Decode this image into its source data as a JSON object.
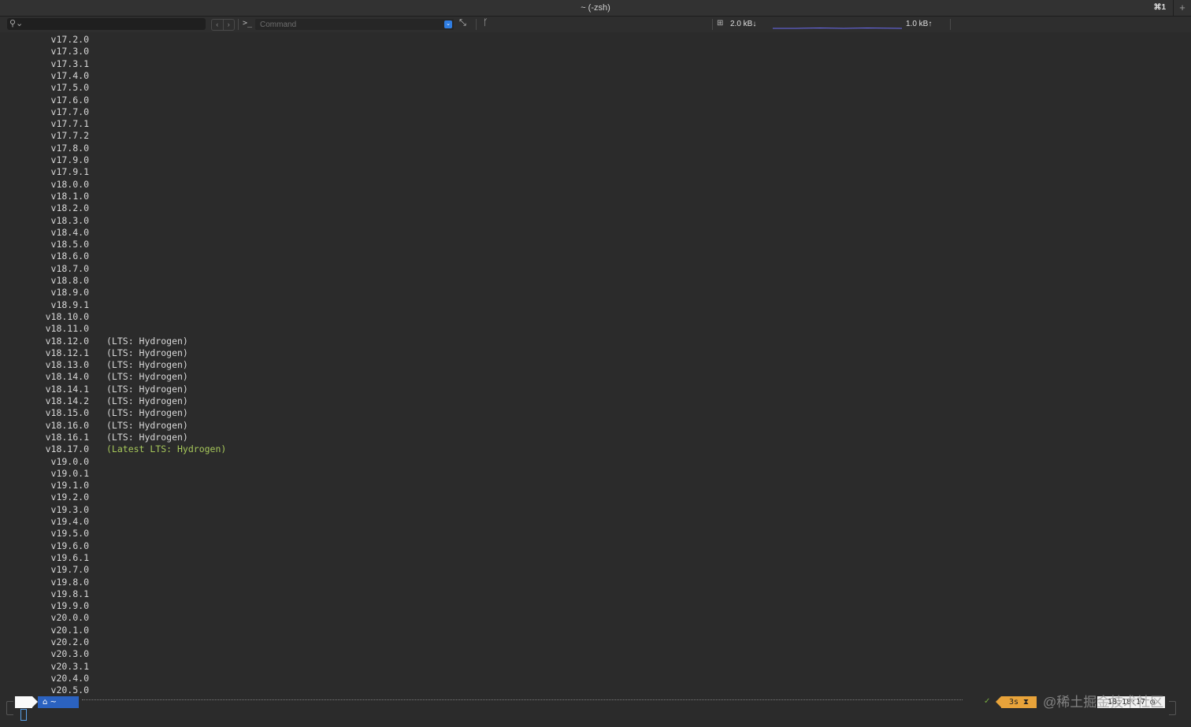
{
  "window": {
    "title": "~ (-zsh)",
    "tab_shortcut": "⌘1",
    "add_tab_icon": "+"
  },
  "toolbar": {
    "search_icon": "⚲⌄",
    "nav_back_icon": "‹",
    "nav_forward_icon": "›",
    "prompt_icon": ">_",
    "command_placeholder": "Command",
    "command_dropdown_icon": "⌄",
    "expand_icon": "⤡",
    "branch_icon": "ᚴ",
    "network_icon": "⊞",
    "network_down": "2.0 kB↓",
    "network_up": "1.0 kB↑",
    "graph_color": "#6b6bf0"
  },
  "terminal": {
    "lines": [
      {
        "version": "v17.2.0",
        "note": ""
      },
      {
        "version": "v17.3.0",
        "note": ""
      },
      {
        "version": "v17.3.1",
        "note": ""
      },
      {
        "version": "v17.4.0",
        "note": ""
      },
      {
        "version": "v17.5.0",
        "note": ""
      },
      {
        "version": "v17.6.0",
        "note": ""
      },
      {
        "version": "v17.7.0",
        "note": ""
      },
      {
        "version": "v17.7.1",
        "note": ""
      },
      {
        "version": "v17.7.2",
        "note": ""
      },
      {
        "version": "v17.8.0",
        "note": ""
      },
      {
        "version": "v17.9.0",
        "note": ""
      },
      {
        "version": "v17.9.1",
        "note": ""
      },
      {
        "version": "v18.0.0",
        "note": ""
      },
      {
        "version": "v18.1.0",
        "note": ""
      },
      {
        "version": "v18.2.0",
        "note": ""
      },
      {
        "version": "v18.3.0",
        "note": ""
      },
      {
        "version": "v18.4.0",
        "note": ""
      },
      {
        "version": "v18.5.0",
        "note": ""
      },
      {
        "version": "v18.6.0",
        "note": ""
      },
      {
        "version": "v18.7.0",
        "note": ""
      },
      {
        "version": "v18.8.0",
        "note": ""
      },
      {
        "version": "v18.9.0",
        "note": ""
      },
      {
        "version": "v18.9.1",
        "note": ""
      },
      {
        "version": "v18.10.0",
        "note": ""
      },
      {
        "version": "v18.11.0",
        "note": ""
      },
      {
        "version": "v18.12.0",
        "note": "(LTS: Hydrogen)"
      },
      {
        "version": "v18.12.1",
        "note": "(LTS: Hydrogen)"
      },
      {
        "version": "v18.13.0",
        "note": "(LTS: Hydrogen)"
      },
      {
        "version": "v18.14.0",
        "note": "(LTS: Hydrogen)"
      },
      {
        "version": "v18.14.1",
        "note": "(LTS: Hydrogen)"
      },
      {
        "version": "v18.14.2",
        "note": "(LTS: Hydrogen)"
      },
      {
        "version": "v18.15.0",
        "note": "(LTS: Hydrogen)"
      },
      {
        "version": "v18.16.0",
        "note": "(LTS: Hydrogen)"
      },
      {
        "version": "v18.16.1",
        "note": "(LTS: Hydrogen)"
      },
      {
        "version": "v18.17.0",
        "note": "(Latest LTS: Hydrogen)",
        "latest": true
      },
      {
        "version": "v19.0.0",
        "note": ""
      },
      {
        "version": "v19.0.1",
        "note": ""
      },
      {
        "version": "v19.1.0",
        "note": ""
      },
      {
        "version": "v19.2.0",
        "note": ""
      },
      {
        "version": "v19.3.0",
        "note": ""
      },
      {
        "version": "v19.4.0",
        "note": ""
      },
      {
        "version": "v19.5.0",
        "note": ""
      },
      {
        "version": "v19.6.0",
        "note": ""
      },
      {
        "version": "v19.6.1",
        "note": ""
      },
      {
        "version": "v19.7.0",
        "note": ""
      },
      {
        "version": "v19.8.0",
        "note": ""
      },
      {
        "version": "v19.8.1",
        "note": ""
      },
      {
        "version": "v19.9.0",
        "note": ""
      },
      {
        "version": "v20.0.0",
        "note": ""
      },
      {
        "version": "v20.1.0",
        "note": ""
      },
      {
        "version": "v20.2.0",
        "note": ""
      },
      {
        "version": "v20.3.0",
        "note": ""
      },
      {
        "version": "v20.3.1",
        "note": ""
      },
      {
        "version": "v20.4.0",
        "note": ""
      },
      {
        "version": "v20.5.0",
        "note": ""
      }
    ],
    "latest_color": "#a6c75a"
  },
  "prompt": {
    "os_icon": "",
    "dir_label": "⌂ ~",
    "status_check": "✓",
    "duration": "3s ⧗",
    "time": "18:18:17 ◷",
    "watermark": "@稀土掘金技术社区",
    "dir_color": "#2b62c0",
    "duration_color": "#e8a33a"
  }
}
